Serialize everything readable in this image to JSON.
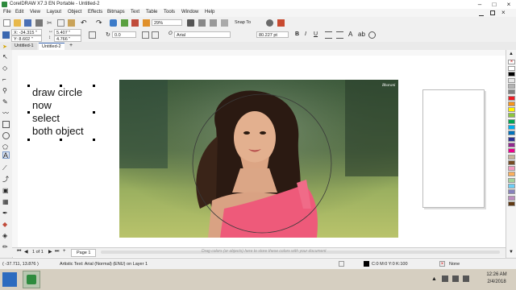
{
  "window": {
    "title": "CorelDRAW X7.3 EN Portable - Untitled-2"
  },
  "menu": [
    "File",
    "Edit",
    "View",
    "Layout",
    "Object",
    "Effects",
    "Bitmaps",
    "Text",
    "Table",
    "Tools",
    "Window",
    "Help"
  ],
  "toolbar": {
    "zoom": "29%",
    "snap_to": "Snap To"
  },
  "propbar": {
    "x": "X: -34.315 \"",
    "y": "Y: 8.602 \"",
    "w": "5.407 \"",
    "h": "4.766 \"",
    "angle": "0.0",
    "font": "Arial",
    "font_size": "80.227 pt"
  },
  "doc_tabs": [
    "Untitled-1",
    "Untitled-2"
  ],
  "canvas": {
    "text_lines": [
      "draw circle",
      "now",
      "select",
      "both object"
    ],
    "watermark": "Bharani"
  },
  "pagebar": {
    "page_info": "1 of 1",
    "page_tab": "Page 1"
  },
  "status": {
    "coords": "( -37.711, 13.876 )",
    "object_info": "Artistic Text: Arial (Normal) (ENU) on Layer 1",
    "hint": "Drag colors (or objects) here to store these colors with your document",
    "color_info": "C:0 M:0 Y:0 K:100",
    "outline": "None"
  },
  "taskbar": {
    "time": "12:26 AM",
    "date": "2/4/2018"
  },
  "colors": {
    "accent": "#2e8b3e",
    "palette": [
      "#ffffff",
      "#000000",
      "#e6e6e6",
      "#b3b3b3",
      "#808080",
      "#ed1c24",
      "#f7941d",
      "#fff200",
      "#8dc63f",
      "#00a651",
      "#00aeef",
      "#0072bc",
      "#2e3192",
      "#92278f",
      "#ec008c",
      "#c7b299",
      "#754c24",
      "#f49ac1",
      "#fbaf5d",
      "#a3d39c",
      "#6dcff6",
      "#8781bd",
      "#bd8cbf",
      "#603913"
    ]
  }
}
